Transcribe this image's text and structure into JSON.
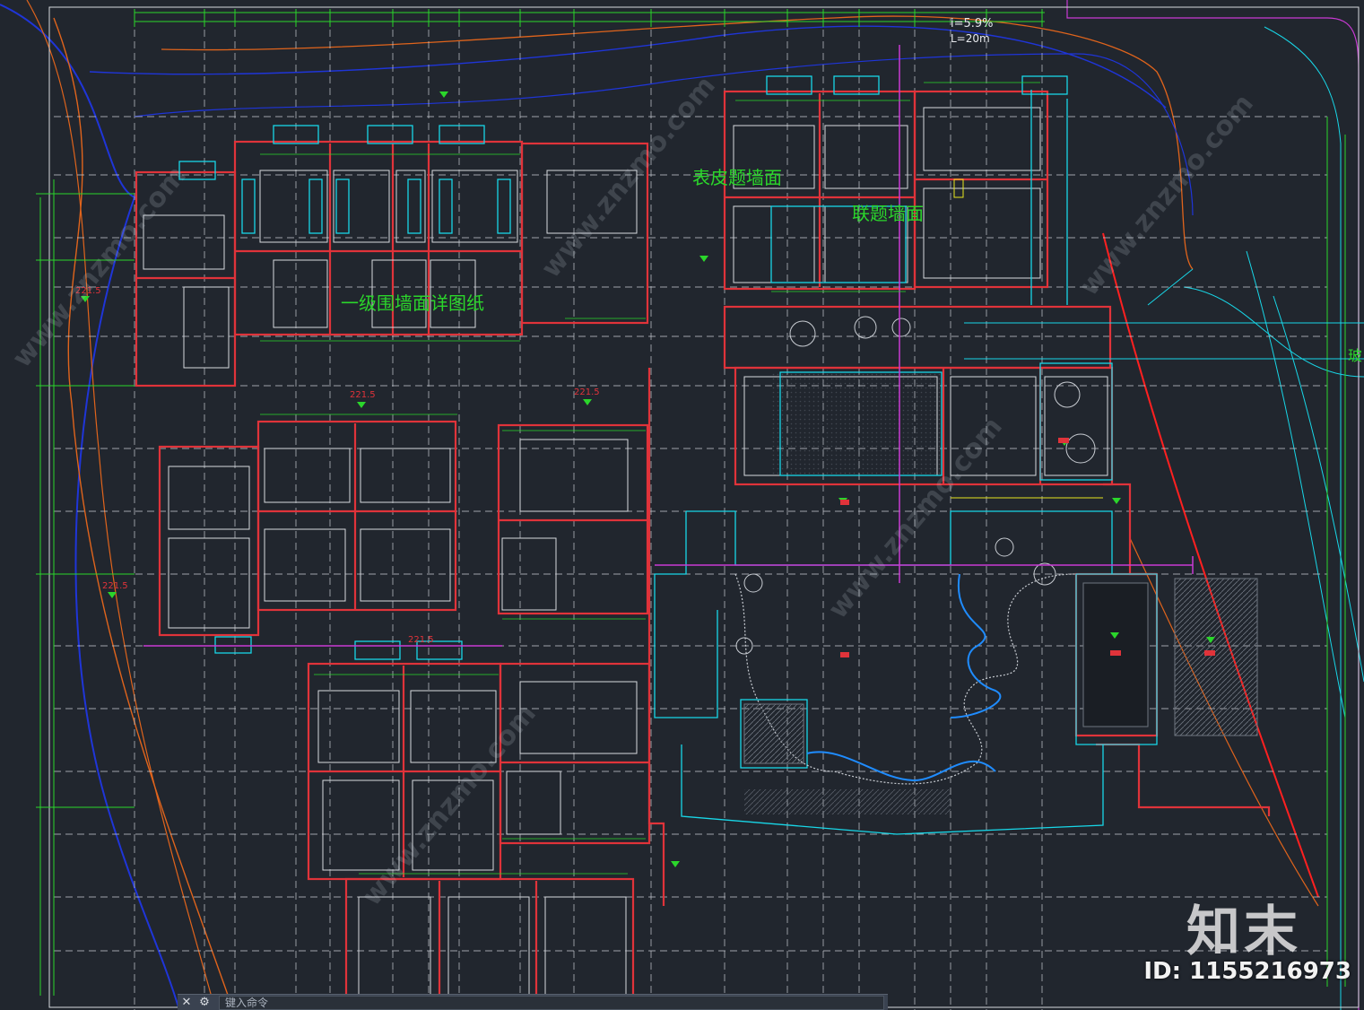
{
  "drawing": {
    "slope_note": "i=5.9%",
    "length_note": "L=20m",
    "room_labels": [
      "表皮题墙面",
      "联题墙面",
      "一级围墙面详图纸"
    ],
    "elevation_tags": [
      "221.5",
      "221.5",
      "221.5",
      "221.5",
      "221.5"
    ],
    "edge_label": "玻"
  },
  "command_line": {
    "close_glyph": "✕",
    "wrench_glyph": "⚙",
    "placeholder": "键入命令"
  },
  "watermark": {
    "logo": "知末",
    "id_text": "ID: 1155216973",
    "site": "www.znzmo.com"
  },
  "colors": {
    "background": "#21262e",
    "wall_red": "#e0333a",
    "dim_green": "#2bd62b",
    "grid_white": "#d6d9de",
    "cyan": "#18d7e8",
    "blue": "#1f35d8",
    "orange": "#e0641c",
    "magenta": "#c93ad4",
    "yellow": "#e6e61f"
  }
}
